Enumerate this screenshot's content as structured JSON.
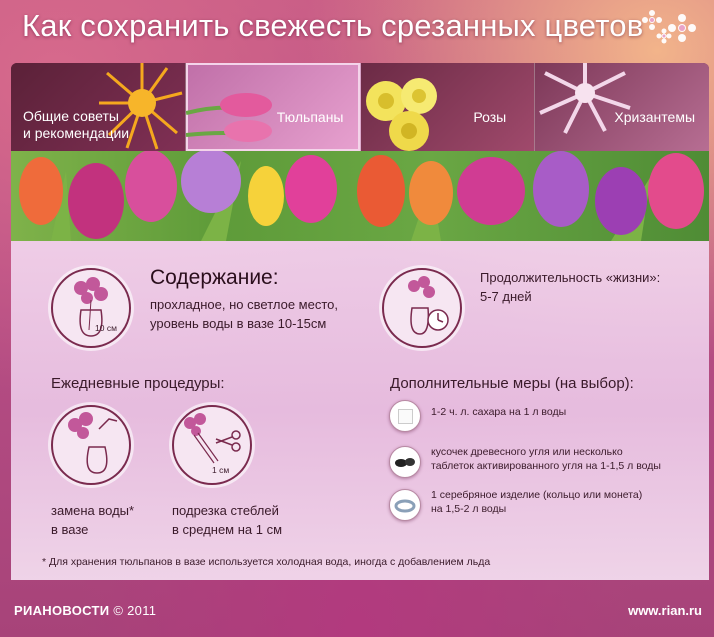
{
  "header": {
    "title": "Как сохранить свежесть срезанных цветов"
  },
  "tabs": [
    {
      "label": "Общие советы\nи рекомендации"
    },
    {
      "label": "Тюльпаны"
    },
    {
      "label": "Розы"
    },
    {
      "label": "Хризантемы"
    }
  ],
  "content": {
    "storage": {
      "heading": "Содержание:",
      "text": "прохладное, но светлое место,\nуровень воды в вазе 10-15см",
      "icon_label": "10 см"
    },
    "lifespan": {
      "text": "Продолжительность «жизни»:\n5-7 дней"
    },
    "daily": {
      "heading": "Ежедневные процедуры:",
      "water": "замена воды*\nв вазе",
      "cut": "подрезка стеблей\nв среднем на 1 см",
      "cut_icon_label": "1 см"
    },
    "extra": {
      "heading": "Дополнительные меры (на выбор):",
      "items": [
        {
          "text": "1-2 ч. л. сахара на 1 л воды",
          "icon": "sugar-icon"
        },
        {
          "text": "кусочек древесного угля или несколько\nтаблеток активированного угля на 1-1,5 л воды",
          "icon": "charcoal-icon"
        },
        {
          "text": "1 серебряное изделие (кольцо или монета)\nна 1,5-2 л воды",
          "icon": "silver-ring-icon"
        }
      ]
    },
    "footnote": "* Для хранения тюльпанов в вазе используется холодная вода, иногда с добавлением льда"
  },
  "footer": {
    "brand": "РИАНОВОСТИ",
    "copyright": "© 2011",
    "url": "www.rian.ru"
  },
  "colors": {
    "accent": "#7a2a4e",
    "panel": "#f0d4ec",
    "tab_active": "#e7a1cf"
  }
}
